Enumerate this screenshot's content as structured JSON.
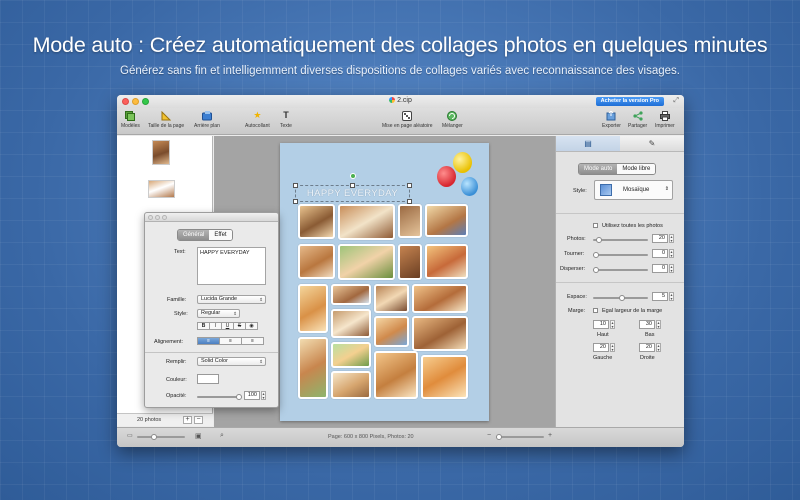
{
  "promo": {
    "headline": "Mode auto : Créez automatiquement des collages photos en quelques minutes",
    "subline": "Générez sans fin et intelligemment diverses dispositions de collages variés avec reconnaissance des visages."
  },
  "window": {
    "title": "2.cip",
    "buy_button": "Acheter la version Pro"
  },
  "toolbar": {
    "items": [
      {
        "label": "Modèles",
        "icon": "templates-icon"
      },
      {
        "label": "Taille de la page",
        "icon": "page-size-icon"
      },
      {
        "label": "Arrière plan",
        "icon": "background-icon"
      },
      {
        "label": "Autocollant",
        "icon": "sticker-star-icon"
      },
      {
        "label": "Texte",
        "icon": "text-icon"
      },
      {
        "label": "Mise en page aléatoire",
        "icon": "dice-icon"
      },
      {
        "label": "Mélanger",
        "icon": "shuffle-icon"
      },
      {
        "label": "Exporter",
        "icon": "export-icon"
      },
      {
        "label": "Partager",
        "icon": "share-icon"
      },
      {
        "label": "Imprimer",
        "icon": "print-icon"
      }
    ]
  },
  "photo_list": {
    "count_label": "20 photos",
    "add": "+",
    "remove": "−"
  },
  "canvas": {
    "banner_text": "HAPPY EVERYDAY"
  },
  "text_panel": {
    "tabs": [
      "Général",
      "Effet"
    ],
    "text_label": "Text:",
    "text_value": "HAPPY EVERYDAY",
    "family_label": "Famille:",
    "family_value": "Lucida Grande",
    "style_label": "Style:",
    "style_value": "Regular",
    "format_buttons": [
      "B",
      "I",
      "U",
      "S"
    ],
    "alignment_label": "Alignement:",
    "fill_label": "Remplir:",
    "fill_value": "Solid Color",
    "color_label": "Couleur:",
    "opacity_label": "Opacité:",
    "opacity_value": "100"
  },
  "right_panel": {
    "mode_auto": "Mode auto",
    "mode_libre": "Mode libre",
    "style_label": "Style:",
    "style_value": "Mosaïque",
    "use_all": "Utilisez toutes les photos",
    "photos_label": "Photos:",
    "photos_value": "20",
    "rotate_label": "Tourner:",
    "rotate_value": "0",
    "scatter_label": "Disperser:",
    "scatter_value": "0",
    "spacing_label": "Espace:",
    "spacing_value": "5",
    "margin_label": "Marge:",
    "equal_margin": "Egal largeur de la marge",
    "top_value": "10",
    "bottom_value": "30",
    "top_label": "Haut",
    "bottom_label": "Bas",
    "left_value": "20",
    "right_value": "20",
    "left_label": "Gauche",
    "right_label": "Droite"
  },
  "status": {
    "page_info": "Page: 600 x 800 Pixels, Photos: 20"
  },
  "colors": {
    "accent": "#1f6fd6",
    "page_bg": "#b3cfe6",
    "canvas_bg": "#a4a4a4"
  }
}
